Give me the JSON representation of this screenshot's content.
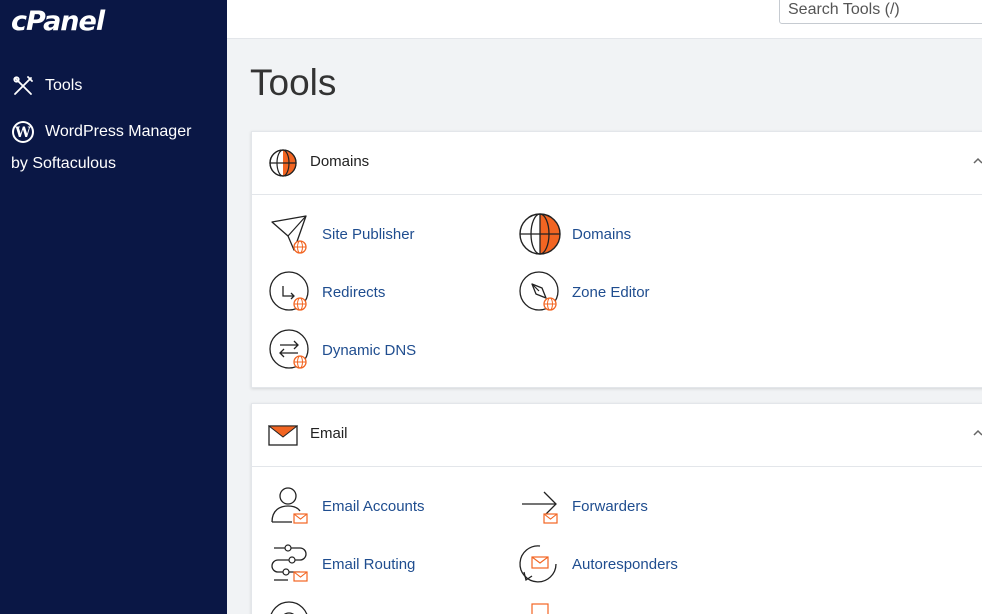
{
  "sidebar": {
    "logo": "cPanel",
    "items": [
      {
        "label": "Tools",
        "icon": "tools-icon"
      },
      {
        "label": "WordPress Manager by Softaculous",
        "icon": "wordpress-icon"
      }
    ]
  },
  "search": {
    "placeholder": "Search Tools (/)"
  },
  "page": {
    "title": "Tools"
  },
  "sections": {
    "domains": {
      "title": "Domains",
      "tools": [
        {
          "label": "Site Publisher",
          "icon": "site-publisher-icon"
        },
        {
          "label": "Domains",
          "icon": "domains-globe-icon"
        },
        {
          "label": "Redirects",
          "icon": "redirects-icon"
        },
        {
          "label": "Zone Editor",
          "icon": "zone-editor-icon"
        },
        {
          "label": "Dynamic DNS",
          "icon": "dynamic-dns-icon"
        }
      ]
    },
    "email": {
      "title": "Email",
      "tools": [
        {
          "label": "Email Accounts",
          "icon": "email-accounts-icon"
        },
        {
          "label": "Forwarders",
          "icon": "forwarders-icon"
        },
        {
          "label": "Email Routing",
          "icon": "email-routing-icon"
        },
        {
          "label": "Autoresponders",
          "icon": "autoresponders-icon"
        }
      ]
    }
  },
  "colors": {
    "sidebar": "#0a1745",
    "accent": "#f26522",
    "link": "#1f4d8f"
  }
}
